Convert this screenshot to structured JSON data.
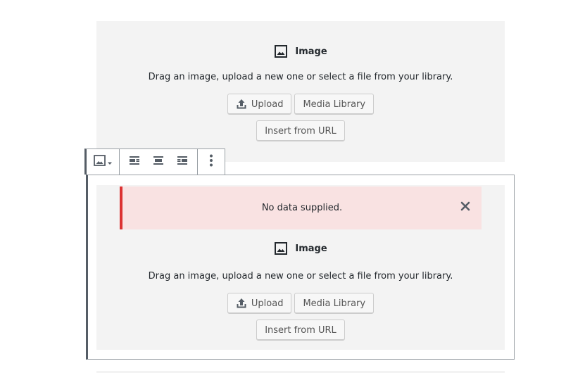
{
  "top_block": {
    "label": "Image",
    "label_icon": "image-icon",
    "instructions": "Drag an image, upload a new one or select a file from your library.",
    "upload_label": "Upload",
    "upload_icon": "upload-icon",
    "media_library_label": "Media Library",
    "insert_url_label": "Insert from URL"
  },
  "toolbar": {
    "block_type_icon": "image-icon",
    "dropdown_icon": "caret-down-icon",
    "align_left_icon": "align-left-icon",
    "align_center_icon": "align-center-icon",
    "align_right_icon": "align-right-icon",
    "more_icon": "more-vertical-icon"
  },
  "selected_block": {
    "notice_text": "No data supplied.",
    "notice_close_icon": "close-icon",
    "notice_color": "#dc3232",
    "label": "Image",
    "label_icon": "image-icon",
    "instructions": "Drag an image, upload a new one or select a file from your library.",
    "upload_label": "Upload",
    "upload_icon": "upload-icon",
    "media_library_label": "Media Library",
    "insert_url_label": "Insert from URL"
  }
}
